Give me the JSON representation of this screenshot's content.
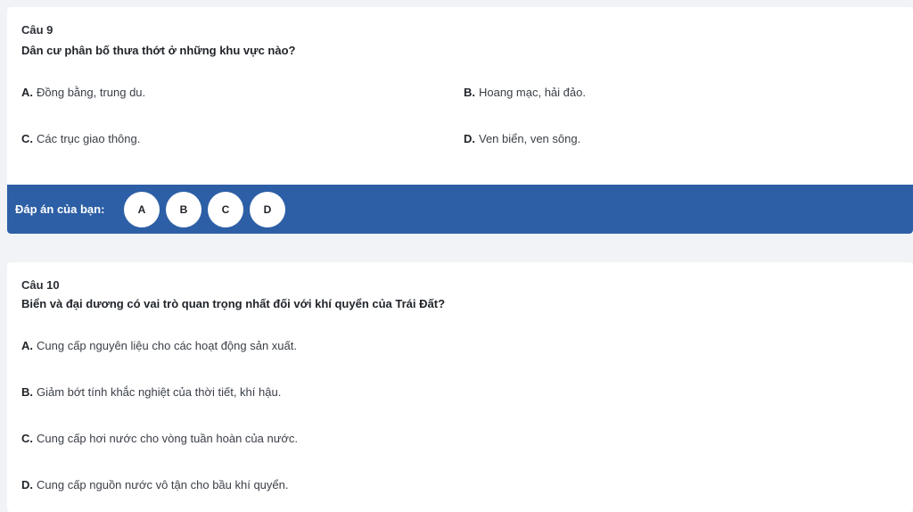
{
  "q9": {
    "number": "Câu 9",
    "question": "Dân cư phân bố thưa thớt ở những khu vực nào?",
    "options": [
      {
        "letter": "A.",
        "text": "Đồng bằng, trung du."
      },
      {
        "letter": "B.",
        "text": "Hoang mạc, hải đảo."
      },
      {
        "letter": "C.",
        "text": "Các trục giao thông."
      },
      {
        "letter": "D.",
        "text": "Ven biển, ven sông."
      }
    ],
    "answer_label": "Đáp án của bạn:",
    "choices": [
      "A",
      "B",
      "C",
      "D"
    ]
  },
  "q10": {
    "number": "Câu 10",
    "question": "Biển và đại dương có vai trò quan trọng nhất đối với khí quyển của Trái Đất?",
    "options": [
      {
        "letter": "A.",
        "text": "Cung cấp nguyên liệu cho các hoạt động sản xuất."
      },
      {
        "letter": "B.",
        "text": "Giảm bớt tính khắc nghiệt của thời tiết, khí hậu."
      },
      {
        "letter": "C.",
        "text": "Cung cấp hơi nước cho vòng tuần hoàn của nước."
      },
      {
        "letter": "D.",
        "text": "Cung cấp nguồn nước vô tận cho bầu khí quyển."
      }
    ]
  },
  "colors": {
    "answer_bar": "#2d5fa6",
    "page_bg": "#f1f3f6"
  }
}
